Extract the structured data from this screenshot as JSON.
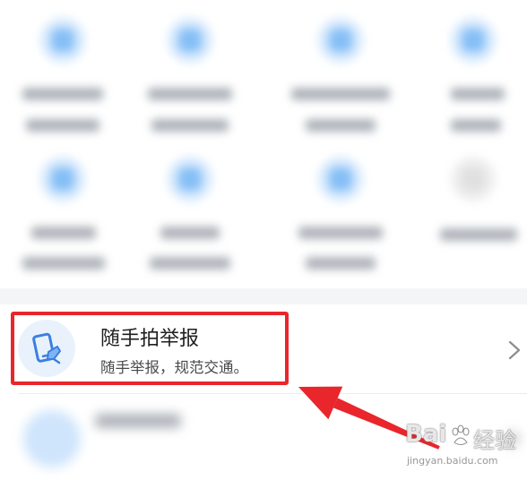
{
  "list": {
    "items": [
      {
        "title": "随手拍举报",
        "subtitle": "随手举报，规范交通。",
        "icon": "phone-report-icon",
        "accent_color": "#3b7fe0",
        "icon_bg_color": "#e9f2fc"
      }
    ]
  },
  "annotation": {
    "highlight_color": "#e8262b",
    "arrow_color": "#e8262b"
  },
  "watermark": {
    "brand": "Bai",
    "brand_cn": "经验",
    "url": "jingyan.baidu.com"
  }
}
